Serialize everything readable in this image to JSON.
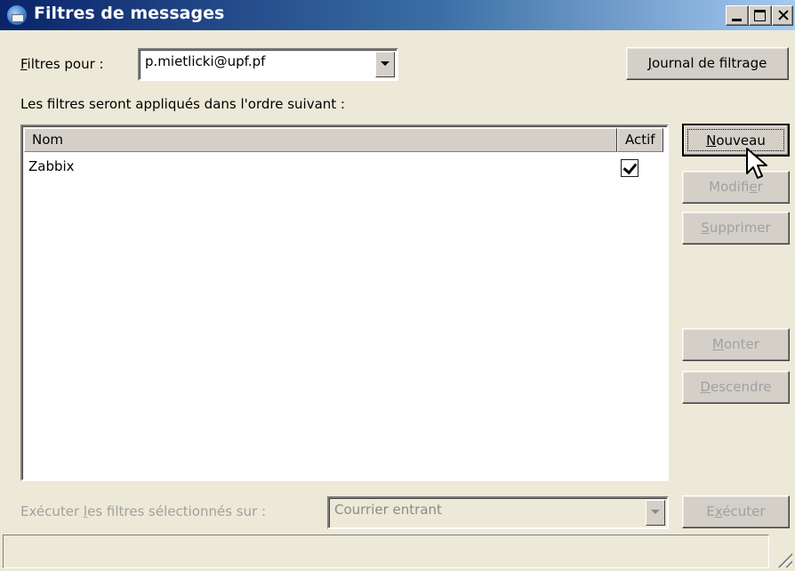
{
  "window": {
    "title": "Filtres de messages",
    "icon": "thunderbird-icon",
    "controls": [
      "minimize-icon",
      "maximize-icon",
      "close-icon"
    ]
  },
  "account": {
    "label_prefix": "",
    "label_mnemonic": "F",
    "label_rest": "iltres pour :",
    "selected": "p.mietlicki@upf.pf"
  },
  "log_button": {
    "mnemonic": "J",
    "rest": "ournal de filtrage"
  },
  "order_text": "Les filtres seront appliqués dans l'ordre suivant :",
  "list": {
    "columns": [
      "Nom",
      "Actif"
    ],
    "rows": [
      {
        "name": "Zabbix",
        "active": true
      }
    ]
  },
  "buttons": {
    "new": {
      "before": "",
      "mnemonic": "N",
      "after": "ouveau",
      "disabled": false,
      "default": true
    },
    "edit": {
      "before": "Modifi",
      "mnemonic": "e",
      "after": "r",
      "disabled": true
    },
    "delete": {
      "before": "",
      "mnemonic": "S",
      "after": "upprimer",
      "disabled": true
    },
    "up": {
      "before": "",
      "mnemonic": "M",
      "after": "onter",
      "disabled": true
    },
    "down": {
      "before": "",
      "mnemonic": "D",
      "after": "escendre",
      "disabled": true
    },
    "run": {
      "before": "E",
      "mnemonic": "x",
      "after": "écuter",
      "disabled": true
    }
  },
  "run_on": {
    "label_before": "Exécuter ",
    "label_mnemonic": "l",
    "label_after": "es filtres sélectionnés sur :",
    "selected": "Courrier entrant",
    "disabled": true
  },
  "colors": {
    "title_start": "#0a246a",
    "title_end": "#a6caf0",
    "face": "#d4d0c8",
    "disabled_text": "#a0a0a0"
  }
}
